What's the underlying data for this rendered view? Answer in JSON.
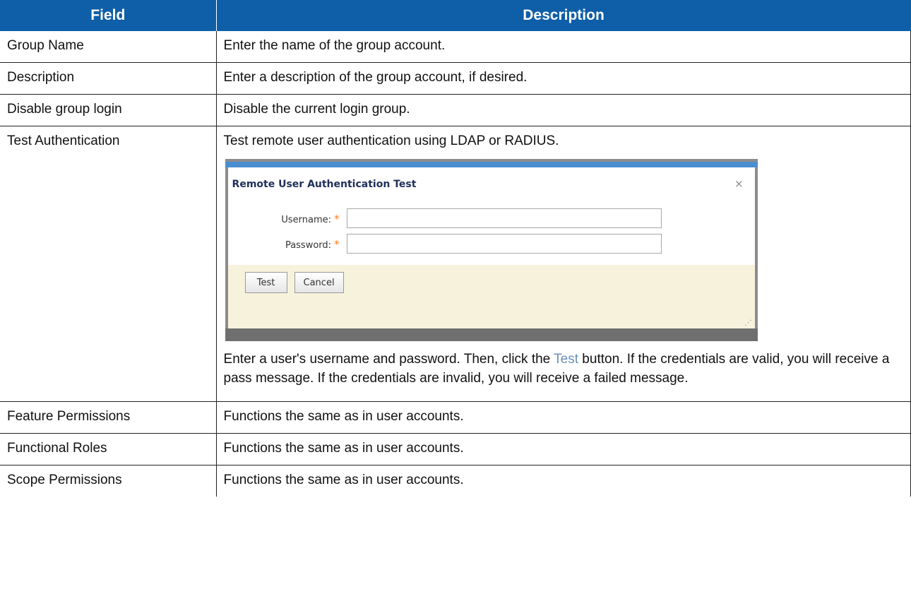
{
  "table": {
    "headers": [
      "Field",
      "Description"
    ],
    "rows": [
      {
        "field": "Group Name",
        "description": "Enter the name of the group account."
      },
      {
        "field": "Description",
        "description": "Enter a description of the group account, if desired."
      },
      {
        "field": "Disable group login",
        "description": "Disable the current login group."
      },
      {
        "field": "Test Authentication",
        "description": "Test remote user authentication using LDAP or RADIUS."
      },
      {
        "field": "Feature Permissions",
        "description": "Functions the same as in user accounts."
      },
      {
        "field": "Functional Roles",
        "description": "Functions the same as in user accounts."
      },
      {
        "field": "Scope Permissions",
        "description": "Functions the same as in user accounts."
      }
    ]
  },
  "dialog": {
    "title": "Remote User Authentication Test",
    "close_symbol": "×",
    "username_label": "Username:",
    "password_label": "Password:",
    "required_mark": "*",
    "username_value": "",
    "password_value": "",
    "test_button": "Test",
    "cancel_button": "Cancel",
    "accent_color": "#4a8ed0",
    "footer_color": "#f7f2dc"
  },
  "test_note": {
    "part1": "Enter a user's username and password. Then, click the ",
    "link": "Test",
    "part2": " button. If the credentials are valid, you will receive a pass message. If the credentials are invalid, you will receive a failed message."
  },
  "colors": {
    "header_bg": "#0f5ea8",
    "link": "#6a8fb7"
  }
}
